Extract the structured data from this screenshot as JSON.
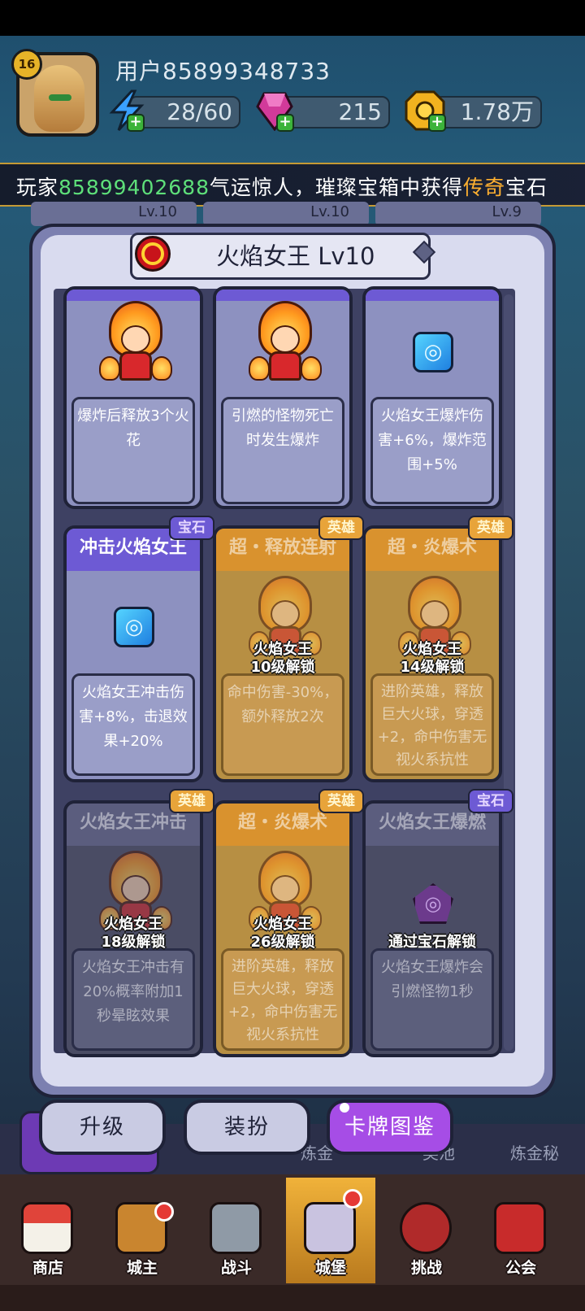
{
  "header": {
    "level": "16",
    "username": "用户85899348733",
    "energy": "28/60",
    "gems": "215",
    "gold": "1.78万"
  },
  "marquee": {
    "prefix": "玩家",
    "player_id": "85899402688",
    "middle": "气运惊人，璀璨宝箱中获得",
    "highlight": "传奇",
    "suffix": "宝石"
  },
  "background_levels": [
    "Lv.10",
    "Lv.10",
    "Lv.9"
  ],
  "modal": {
    "title": "火焰女王  Lv10"
  },
  "cards": [
    {
      "type": "unlocked-hero",
      "desc": "爆炸后释放3个火花"
    },
    {
      "type": "unlocked-hero",
      "desc": "引燃的怪物死亡时发生爆炸"
    },
    {
      "type": "unlocked-gem",
      "desc": "火焰女王爆炸伤害+6%，爆炸范围+5%"
    },
    {
      "type": "gem",
      "title": "冲击火焰女王",
      "tag": "宝石",
      "desc": "火焰女王冲击伤害+8%，击退效果+20%"
    },
    {
      "type": "hero",
      "title": "超・释放连射",
      "tag": "英雄",
      "unlock_name": "火焰女王",
      "unlock_level": "10级解锁",
      "desc": "命中伤害-30%，额外释放2次"
    },
    {
      "type": "hero",
      "title": "超・炎爆术",
      "tag": "英雄",
      "unlock_name": "火焰女王",
      "unlock_level": "14级解锁",
      "desc": "进阶英雄，释放巨大火球，穿透+2，命中伤害无视火系抗性"
    },
    {
      "type": "hero",
      "title": "火焰女王冲击",
      "tag": "英雄",
      "unlock_name": "火焰女王",
      "unlock_level": "18级解锁",
      "desc": "火焰女王冲击有20%概率附加1秒晕眩效果"
    },
    {
      "type": "hero",
      "title": "超・炎爆术",
      "tag": "英雄",
      "unlock_name": "火焰女王",
      "unlock_level": "26级解锁",
      "desc": "进阶英雄，释放巨大火球，穿透+2，命中伤害无视火系抗性"
    },
    {
      "type": "gem-locked",
      "title": "火焰女王爆燃",
      "tag": "宝石",
      "unlock_text": "通过宝石解锁",
      "desc": "火焰女王爆炸会引燃怪物1秒"
    }
  ],
  "buttons": {
    "upgrade": "升级",
    "dress": "装扮",
    "cards": "卡牌图鉴"
  },
  "subtabs": [
    "炼金",
    "奖池",
    "炼金秘"
  ],
  "nav": [
    {
      "label": "商店"
    },
    {
      "label": "城主"
    },
    {
      "label": "战斗"
    },
    {
      "label": "城堡"
    },
    {
      "label": "挑战"
    },
    {
      "label": "公会"
    }
  ],
  "colors": {
    "accent_purple": "#a64de6",
    "gem_tag": "#6d5ad4",
    "hero_tag": "#e8a43a",
    "marquee_id": "#5ee07a",
    "marquee_legend": "#ffb030"
  }
}
